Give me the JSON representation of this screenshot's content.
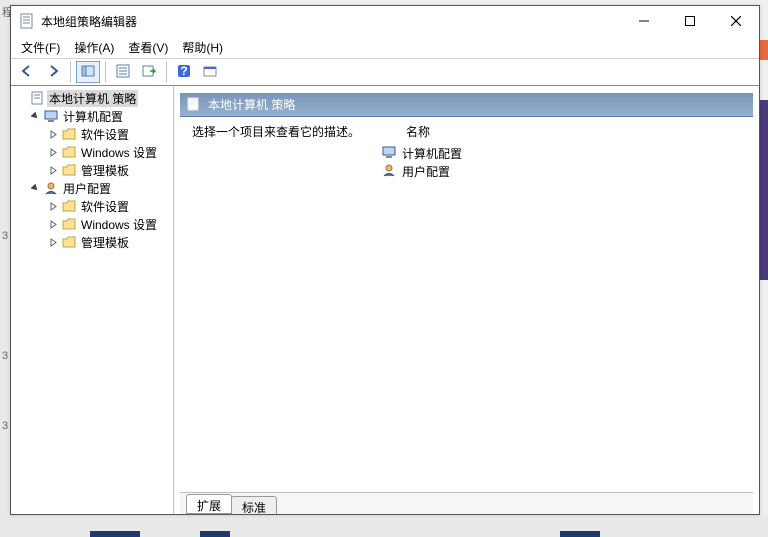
{
  "window": {
    "title": "本地组策略编辑器"
  },
  "menu": {
    "file": "文件(F)",
    "action": "操作(A)",
    "view": "查看(V)",
    "help": "帮助(H)"
  },
  "tree": {
    "root": "本地计算机 策略",
    "computer": "计算机配置",
    "user": "用户配置",
    "software": "软件设置",
    "windows": "Windows 设置",
    "templates": "管理模板"
  },
  "right": {
    "header": "本地计算机 策略",
    "desc": "选择一个项目来查看它的描述。",
    "colName": "名称",
    "items": {
      "computer": "计算机配置",
      "user": "用户配置"
    }
  },
  "tabs": {
    "extended": "扩展",
    "standard": "标准"
  },
  "bgLeft": {
    "a": "程",
    "b": "3",
    "c": "3",
    "d": "3"
  }
}
